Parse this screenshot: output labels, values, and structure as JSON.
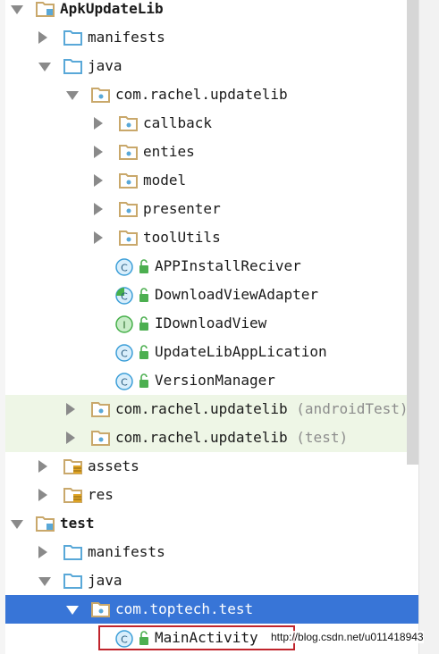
{
  "tree": {
    "rows": [
      {
        "label": "ApkUpdateLib",
        "bold": true,
        "icon": "module-folder-icon",
        "arrow": "expanded"
      },
      {
        "label": "manifests",
        "icon": "folder-icon",
        "arrow": "collapsed"
      },
      {
        "label": "java",
        "icon": "folder-icon",
        "arrow": "expanded"
      },
      {
        "label": "com.rachel.updatelib",
        "icon": "package-icon",
        "arrow": "expanded"
      },
      {
        "label": "callback",
        "icon": "package-icon",
        "arrow": "collapsed"
      },
      {
        "label": "enties",
        "icon": "package-icon",
        "arrow": "collapsed"
      },
      {
        "label": "model",
        "icon": "package-icon",
        "arrow": "collapsed"
      },
      {
        "label": "presenter",
        "icon": "package-icon",
        "arrow": "collapsed"
      },
      {
        "label": "toolUtils",
        "icon": "package-icon",
        "arrow": "collapsed"
      },
      {
        "label": "APPInstallReciver",
        "icon": "class-icon",
        "arrow": "none"
      },
      {
        "label": "DownloadViewAdapter",
        "icon": "abstract-class-icon",
        "arrow": "none"
      },
      {
        "label": "IDownloadView",
        "icon": "interface-icon",
        "arrow": "none"
      },
      {
        "label": "UpdateLibAppLication",
        "icon": "class-icon",
        "arrow": "none"
      },
      {
        "label": "VersionManager",
        "icon": "class-icon",
        "arrow": "none"
      },
      {
        "label": "com.rachel.updatelib",
        "suffix": " (androidTest)",
        "icon": "package-icon",
        "arrow": "collapsed"
      },
      {
        "label": "com.rachel.updatelib",
        "suffix": " (test)",
        "icon": "package-icon",
        "arrow": "collapsed"
      },
      {
        "label": "assets",
        "icon": "resource-folder-icon",
        "arrow": "collapsed"
      },
      {
        "label": "res",
        "icon": "resource-folder-icon",
        "arrow": "collapsed"
      },
      {
        "label": "test",
        "bold": true,
        "icon": "module-folder-icon",
        "arrow": "expanded"
      },
      {
        "label": "manifests",
        "icon": "folder-icon",
        "arrow": "collapsed"
      },
      {
        "label": "java",
        "icon": "folder-icon",
        "arrow": "expanded"
      },
      {
        "label": "com.toptech.test",
        "icon": "package-icon",
        "arrow": "expanded",
        "selected": true
      },
      {
        "label": "MainActivity",
        "icon": "class-icon",
        "arrow": "none"
      }
    ]
  },
  "watermark": "http://blog.csdn.net/u011418943",
  "colors": {
    "selection": "#3875d7",
    "test_source_bg": "#eef6e6",
    "folder_tan": "#c9a86b",
    "folder_blue": "#59a8d8",
    "class_blue": "#3d9fd8",
    "interface_green": "#46b04a",
    "highlight_red": "#c0242c"
  }
}
